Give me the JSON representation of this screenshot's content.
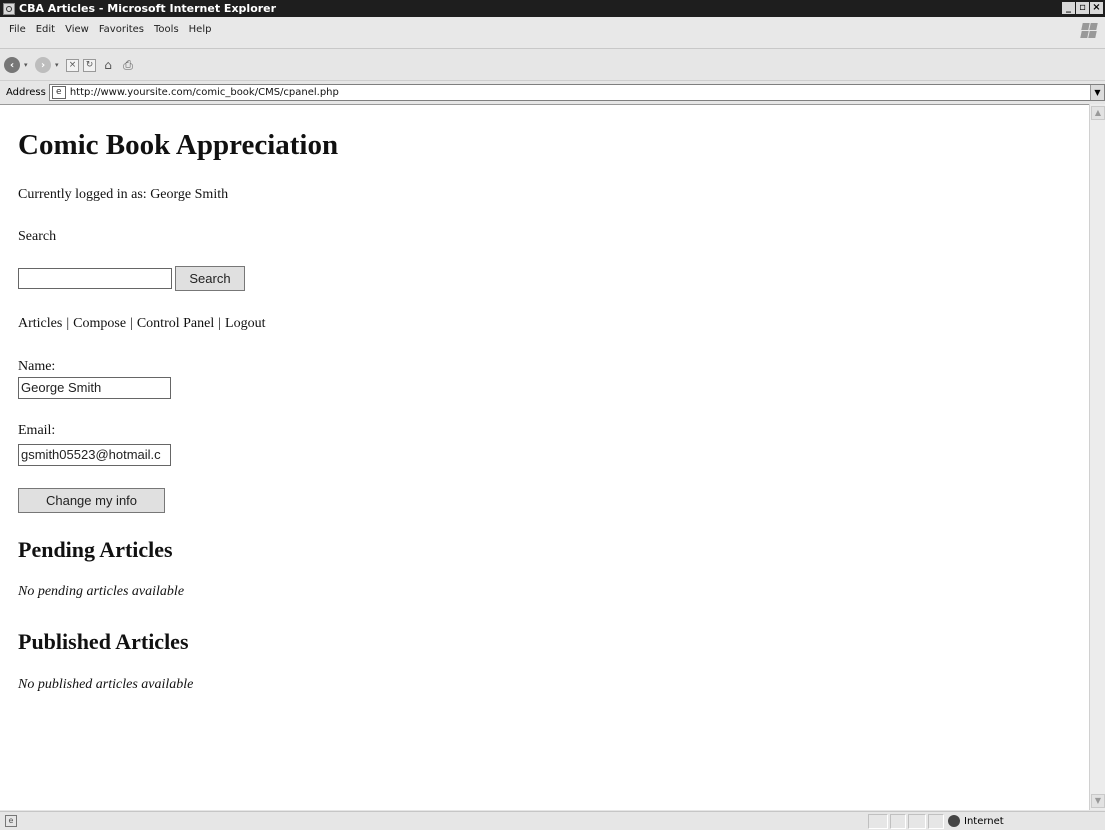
{
  "window": {
    "title": "CBA Articles - Microsoft Internet Explorer",
    "controls": [
      "_",
      "̅",
      "×"
    ]
  },
  "menubar": {
    "items": [
      "File",
      "Edit",
      "View",
      "Favorites",
      "Tools",
      "Help"
    ]
  },
  "toolbar": {
    "icons": [
      "back-icon",
      "forward-icon",
      "stop-icon",
      "refresh-icon",
      "home-icon",
      "print-icon"
    ]
  },
  "addressbar": {
    "label": "Address",
    "url": "http://www.yoursite.com/comic_book/CMS/cpanel.php"
  },
  "page": {
    "site_title": "Comic Book Appreciation",
    "logged_in": "Currently logged in as: George Smith",
    "search_heading": "Search",
    "search_value": "",
    "search_button": "Search",
    "nav": {
      "articles": "Articles",
      "compose": "Compose",
      "control_panel": "Control Panel",
      "logout": "Logout",
      "separator": "|"
    },
    "name_label": "Name:",
    "name_value": "George Smith",
    "email_label": "Email:",
    "email_value": "gsmith05523@hotmail.c",
    "change_button": "Change my info",
    "pending_heading": "Pending Articles",
    "pending_empty": "No pending articles available",
    "published_heading": "Published Articles",
    "published_empty": "No published articles available"
  },
  "statusbar": {
    "zone": "Internet"
  }
}
